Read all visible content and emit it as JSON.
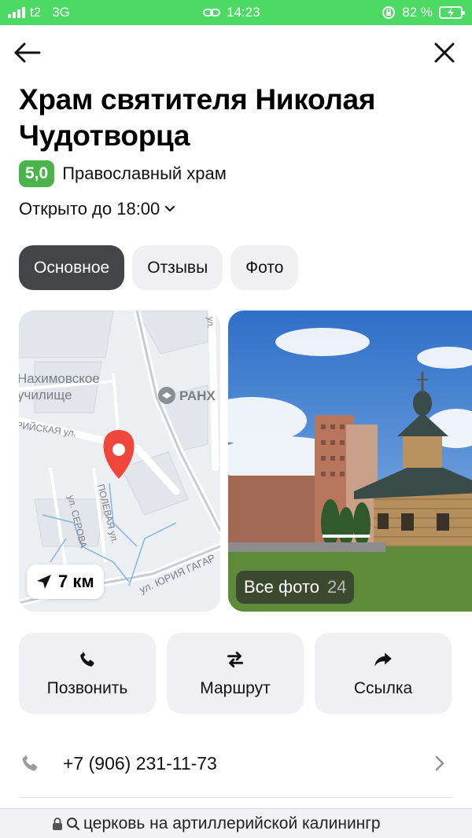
{
  "status_bar": {
    "carrier": "t2",
    "network": "3G",
    "time": "14:23",
    "battery": "82 %"
  },
  "place": {
    "title": "Храм святителя Николая Чудотворца",
    "rating": "5,0",
    "category": "Православный храм",
    "hours": "Открыто до 18:00"
  },
  "tabs": [
    {
      "label": "Основное",
      "active": true
    },
    {
      "label": "Отзывы",
      "active": false
    },
    {
      "label": "Фото",
      "active": false
    }
  ],
  "map": {
    "distance": "7 км",
    "labels": {
      "school_1": "Нахимовское",
      "school_2": "училище",
      "street_1": "РИЙСКАЯ ул.",
      "ranh": "РАНХ",
      "street_2": "ПОЛЕВАЯ ул.",
      "street_3": "ул. СЕРОВА",
      "street_4": "ул. ЮРИЯ ГАГАР",
      "street_5": "ул."
    }
  },
  "photo": {
    "all_label": "Все фото",
    "count": "24"
  },
  "actions": [
    {
      "label": "Позвонить",
      "icon": "phone-icon"
    },
    {
      "label": "Маршрут",
      "icon": "route-icon"
    },
    {
      "label": "Ссылка",
      "icon": "share-icon"
    }
  ],
  "contact": {
    "phone": "+7 (906) 231-11-73"
  },
  "browser": {
    "query": "церковь на артиллерийской калинингр"
  },
  "colors": {
    "status_bar": "#4cd964",
    "rating": "#4bb34b",
    "pin": "#f0473d",
    "active_tab": "#444549"
  }
}
